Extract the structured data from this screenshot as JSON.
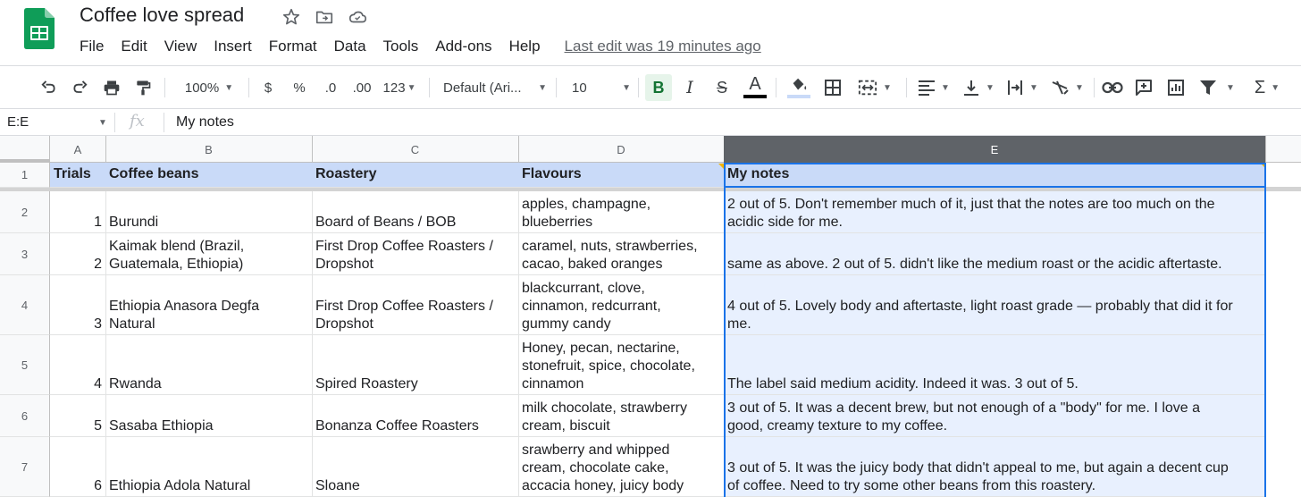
{
  "app": {
    "title": "Coffee love spread",
    "last_edit": "Last edit was 19 minutes ago",
    "menu": [
      "File",
      "Edit",
      "View",
      "Insert",
      "Format",
      "Data",
      "Tools",
      "Add-ons",
      "Help"
    ]
  },
  "toolbar": {
    "zoom": "100%",
    "currency": "$",
    "percent": "%",
    "decrease_decimals": ".0",
    "increase_decimals": ".00",
    "more_formats": "123",
    "font": "Default (Ari...",
    "font_size": "10",
    "bold": "B",
    "italic": "I",
    "strikethrough": "S",
    "text_color": "A",
    "text_color_swatch": "#000000",
    "fill_color_swatch": "#c9daf8"
  },
  "formula_bar": {
    "name_box": "E:E",
    "fx": "fx",
    "value": "My notes"
  },
  "grid": {
    "columns": [
      "A",
      "B",
      "C",
      "D",
      "E"
    ],
    "selected_column": "E",
    "header_fill": "#c9daf8",
    "selection_color": "#1a73e8",
    "header_row": {
      "number": "1",
      "cells": [
        "Trials",
        "Coffee beans",
        "Roastery",
        "Flavours",
        "My notes"
      ]
    },
    "rows": [
      {
        "number": "2",
        "trial": "1",
        "beans": [
          "Burundi"
        ],
        "roastery": [
          "Board of Beans / BOB"
        ],
        "flavours": [
          "apples, champagne,",
          "blueberries"
        ],
        "notes": [
          "2 out of 5. Don't remember much of it, just that the notes are too much on the",
          "acidic side for me."
        ]
      },
      {
        "number": "3",
        "trial": "2",
        "beans": [
          "Kaimak blend (Brazil,",
          "Guatemala, Ethiopia)"
        ],
        "roastery": [
          "First Drop Coffee Roasters /",
          "Dropshot"
        ],
        "flavours": [
          "caramel, nuts, strawberries,",
          "cacao, baked oranges"
        ],
        "notes": [
          "same as above. 2 out of 5. didn't like the medium roast or the acidic aftertaste."
        ]
      },
      {
        "number": "4",
        "trial": "3",
        "beans": [
          "Ethiopia Anasora Degfa",
          "Natural"
        ],
        "roastery": [
          "First Drop Coffee Roasters /",
          "Dropshot"
        ],
        "flavours": [
          "blackcurrant, clove,",
          "cinnamon, redcurrant,",
          "gummy candy"
        ],
        "notes": [
          "4 out of 5. Lovely body and aftertaste, light roast grade — probably that did it for",
          "me."
        ]
      },
      {
        "number": "5",
        "trial": "4",
        "beans": [
          "Rwanda"
        ],
        "roastery": [
          "Spired Roastery"
        ],
        "flavours": [
          "Honey, pecan, nectarine,",
          "stonefruit, spice, chocolate,",
          "cinnamon"
        ],
        "notes": [
          "The label said medium acidity. Indeed it was. 3 out of 5."
        ]
      },
      {
        "number": "6",
        "trial": "5",
        "beans": [
          "Sasaba Ethiopia"
        ],
        "roastery": [
          "Bonanza Coffee Roasters"
        ],
        "flavours": [
          "milk chocolate, strawberry",
          "cream, biscuit"
        ],
        "notes": [
          "3 out of 5. It was a decent brew, but not enough of a \"body\" for me. I love a",
          "good, creamy texture to my coffee."
        ]
      },
      {
        "number": "7",
        "trial": "6",
        "beans": [
          "Ethiopia Adola Natural"
        ],
        "roastery": [
          "Sloane"
        ],
        "flavours": [
          "srawberry and whipped",
          "cream, chocolate cake,",
          "accacia honey, juicy body"
        ],
        "notes": [
          "3 out of 5. It was the juicy body that didn't appeal to me, but again a decent cup",
          "of coffee. Need to try some other beans from this roastery."
        ]
      }
    ]
  }
}
